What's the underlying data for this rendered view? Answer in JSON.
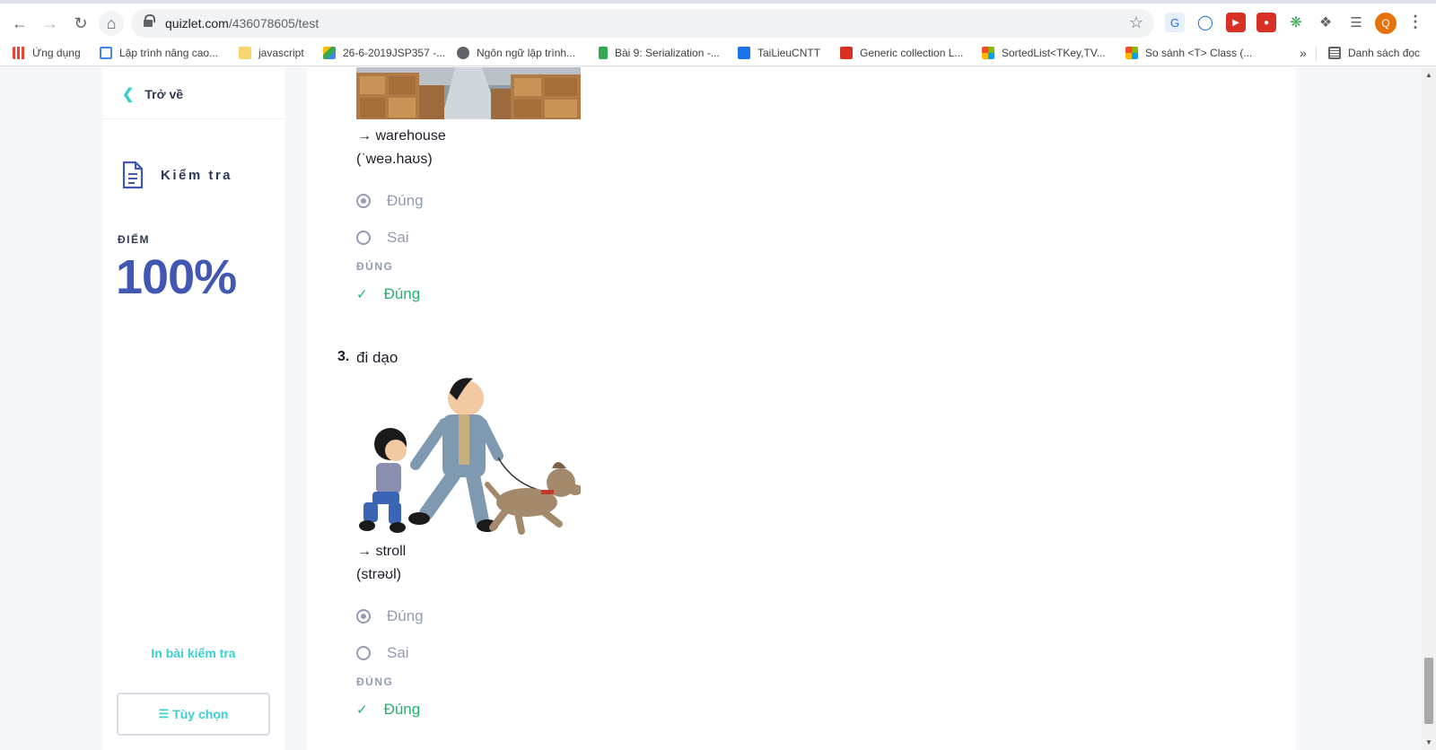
{
  "browser": {
    "url_host": "quizlet.com",
    "url_path": "/436078605/test",
    "avatar_letter": "Q",
    "bookmarks": [
      {
        "label": "Ứng dụng",
        "color": "#ea4335"
      },
      {
        "label": "Lập trình nâng cao...",
        "color": "#4285f4"
      },
      {
        "label": "javascript",
        "color": "#f5d76e"
      },
      {
        "label": "26-6-2019JSP357 -...",
        "color": "#34a853"
      },
      {
        "label": "Ngôn ngữ lập trình...",
        "color": "#5f6368"
      },
      {
        "label": "Bài 9: Serialization -...",
        "color": "#34a853"
      },
      {
        "label": "TaiLieuCNTT",
        "color": "#1a73e8"
      },
      {
        "label": "Generic collection L...",
        "color": "#d93025"
      },
      {
        "label": "SortedList<TKey,TV...",
        "color": "#f9ab00"
      },
      {
        "label": "So sánh <T> Class (...",
        "color": "#f9ab00"
      }
    ],
    "more_bookmarks": "»",
    "reading_list": "Danh sách đọc"
  },
  "sidebar": {
    "back_label": "Trở về",
    "test_title": "Kiểm tra",
    "score_label": "ĐIỂM",
    "score_value": "100%",
    "print_label": "In bài kiểm tra",
    "options_label": "Tùy chọn"
  },
  "questions": [
    {
      "term_line1": "→ warehouse",
      "term_line2": "(ˈweə.haʊs)",
      "option_true": "Đúng",
      "option_false": "Sai",
      "selected": "true",
      "answer_label": "ĐÚNG",
      "answer_value": "Đúng",
      "image": "warehouse-image"
    },
    {
      "number": "3.",
      "prompt": "đi dạo",
      "term_line1": "→ stroll",
      "term_line2": "(strəʊl)",
      "option_true": "Đúng",
      "option_false": "Sai",
      "selected": "true",
      "answer_label": "ĐÚNG",
      "answer_value": "Đúng",
      "image": "walking-family-image"
    }
  ],
  "colors": {
    "accent_blue": "#4257b2",
    "teal": "#3ccfcf",
    "correct_green": "#23b26d",
    "muted": "#939bb4"
  }
}
